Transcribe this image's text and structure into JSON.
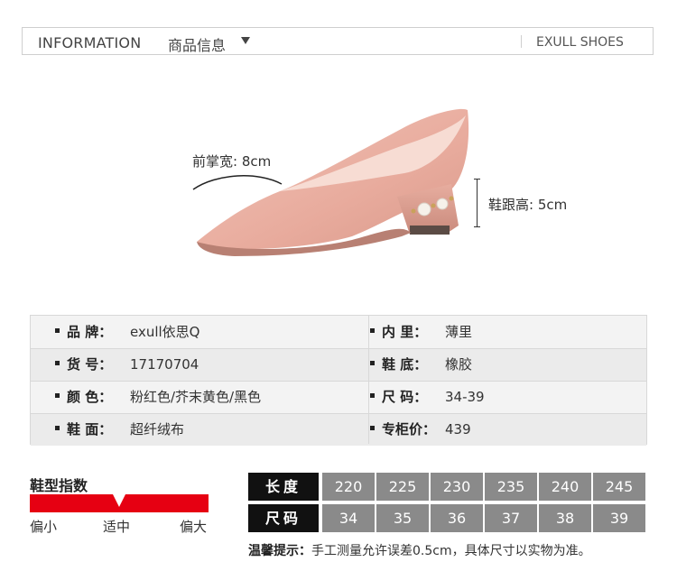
{
  "header": {
    "title_en": "INFORMATION",
    "title_cn": "商品信息",
    "brand": "EXULL SHOES"
  },
  "measurements": {
    "forefoot_width": "前掌宽: 8cm",
    "heel_height": "鞋跟高: 5cm"
  },
  "info": {
    "rows": [
      {
        "left_label": "品 牌：",
        "left_value": "exull依思Q",
        "right_label": "内 里：",
        "right_value": "薄里"
      },
      {
        "left_label": "货 号：",
        "left_value": "17170704",
        "right_label": "鞋 底：",
        "right_value": "橡胶"
      },
      {
        "left_label": "颜 色：",
        "left_value": "粉红色/芥末黄色/黑色",
        "right_label": "尺 码：",
        "right_value": "34-39"
      },
      {
        "left_label": "鞋 面：",
        "left_value": "超纤绒布",
        "right_label": "专柜价：",
        "right_value": "439"
      }
    ]
  },
  "shoe_type": {
    "title": "鞋型指数",
    "scale": [
      "偏小",
      "适中",
      "偏大"
    ],
    "indicator_position": 0.5,
    "bar_color": "#e60012"
  },
  "size_chart": {
    "length_label": "长度",
    "size_label": "尺码",
    "lengths": [
      "220",
      "225",
      "230",
      "235",
      "240",
      "245"
    ],
    "sizes": [
      "34",
      "35",
      "36",
      "37",
      "38",
      "39"
    ]
  },
  "note": {
    "label": "温馨提示：",
    "text": "手工测量允许误差0.5cm，具体尺寸以实物为准。"
  }
}
